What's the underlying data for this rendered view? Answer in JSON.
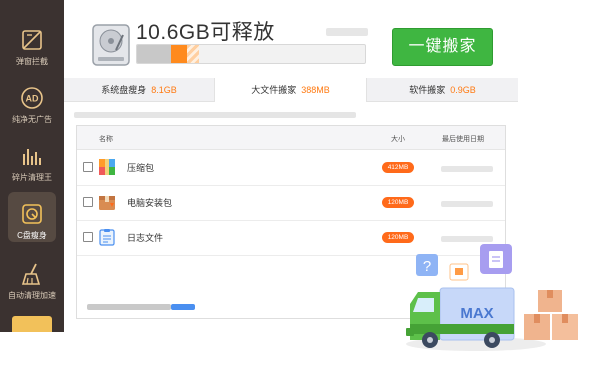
{
  "sidebar": {
    "items": [
      {
        "label": "弹窗拦截",
        "icon": "popup-block-icon"
      },
      {
        "label": "纯净无广告",
        "icon": "ad-block-icon"
      },
      {
        "label": "碎片清理王",
        "icon": "fragment-cleaner-icon"
      },
      {
        "label": "C盘瘦身",
        "icon": "disk-slim-icon",
        "active": true
      },
      {
        "label": "自动清理加速",
        "icon": "broom-icon"
      }
    ]
  },
  "header": {
    "headline": "10.6GB可释放",
    "action_label": "一键搬家",
    "usage_used_fraction": 0.15,
    "usage_movable_fraction": 0.07,
    "usage_freeable_fraction": 0.05
  },
  "tabs": [
    {
      "name": "系统盘瘦身",
      "value": "8.1GB"
    },
    {
      "name": "大文件搬家",
      "value": "388MB",
      "active": true
    },
    {
      "name": "软件搬家",
      "value": "0.9GB"
    }
  ],
  "table": {
    "columns": {
      "name": "名称",
      "size": "大小",
      "date": "最后使用日期"
    },
    "rows": [
      {
        "name": "压缩包",
        "size": "412MB",
        "icon": "archive-icon"
      },
      {
        "name": "电脑安装包",
        "size": "120MB",
        "icon": "installer-package-icon"
      },
      {
        "name": "日志文件",
        "size": "120MB",
        "icon": "log-file-icon"
      }
    ]
  },
  "illustration": {
    "truck_text": "MAX"
  },
  "colors": {
    "sidebar_bg": "#3b3230",
    "accent_orange": "#ff7a12",
    "primary_green": "#3fb641",
    "scroll_blue": "#4a8ff0"
  }
}
